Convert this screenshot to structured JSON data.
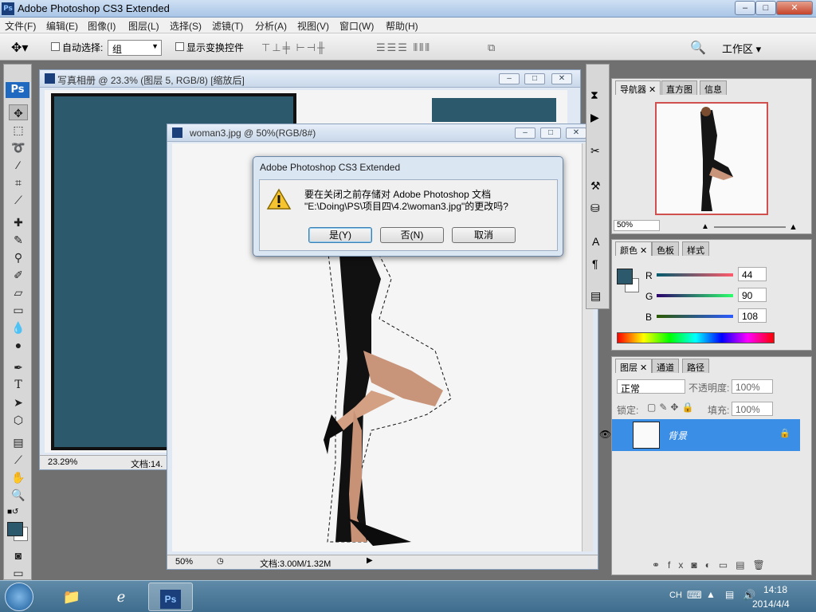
{
  "app": {
    "title": "Adobe Photoshop CS3 Extended",
    "window_buttons": [
      "–",
      "□",
      "✕"
    ]
  },
  "menu": [
    "文件(F)",
    "编辑(E)",
    "图像(I)",
    "图层(L)",
    "选择(S)",
    "滤镜(T)",
    "分析(A)",
    "视图(V)",
    "窗口(W)",
    "帮助(H)"
  ],
  "options_bar": {
    "auto_select_label": "自动选择:",
    "auto_select_value": "组",
    "show_transform_label": "显示变换控件",
    "workspace_label": "工作区"
  },
  "doc1": {
    "title": "写真相册 @ 23.3% (图层 5, RGB/8) [缩放后]",
    "zoom": "23.29%",
    "doc_info": "文档:14."
  },
  "doc2": {
    "title": "woman3.jpg @ 50%(RGB/8#)",
    "zoom": "50%",
    "doc_info": "文档:3.00M/1.32M"
  },
  "dialog": {
    "title": "Adobe Photoshop CS3 Extended",
    "message_line1": "要在关闭之前存储对 Adobe Photoshop 文档",
    "message_line2": "\"E:\\Doing\\PS\\项目四\\4.2\\woman3.jpg\"的更改吗?",
    "yes": "是(Y)",
    "no": "否(N)",
    "cancel": "取消"
  },
  "navigator": {
    "tabs": [
      "导航器",
      "直方图",
      "信息"
    ],
    "zoom": "50%"
  },
  "color_panel": {
    "tabs": [
      "颜色",
      "色板",
      "样式"
    ],
    "r_label": "R",
    "r_value": "44",
    "g_label": "G",
    "g_value": "90",
    "b_label": "B",
    "b_value": "108",
    "fg_color": "#2c5a6c"
  },
  "layers_panel": {
    "tabs": [
      "图层",
      "通道",
      "路径"
    ],
    "blend_mode": "正常",
    "opacity_label": "不透明度:",
    "opacity_value": "100%",
    "lock_label": "锁定:",
    "fill_label": "填充:",
    "fill_value": "100%",
    "layer_name": "背景"
  },
  "taskbar": {
    "lang": "CH",
    "time": "14:18",
    "date": "2014/4/4"
  },
  "colors": {
    "teal": "#2c5a6c",
    "selection_blue": "#3a8ee6"
  }
}
